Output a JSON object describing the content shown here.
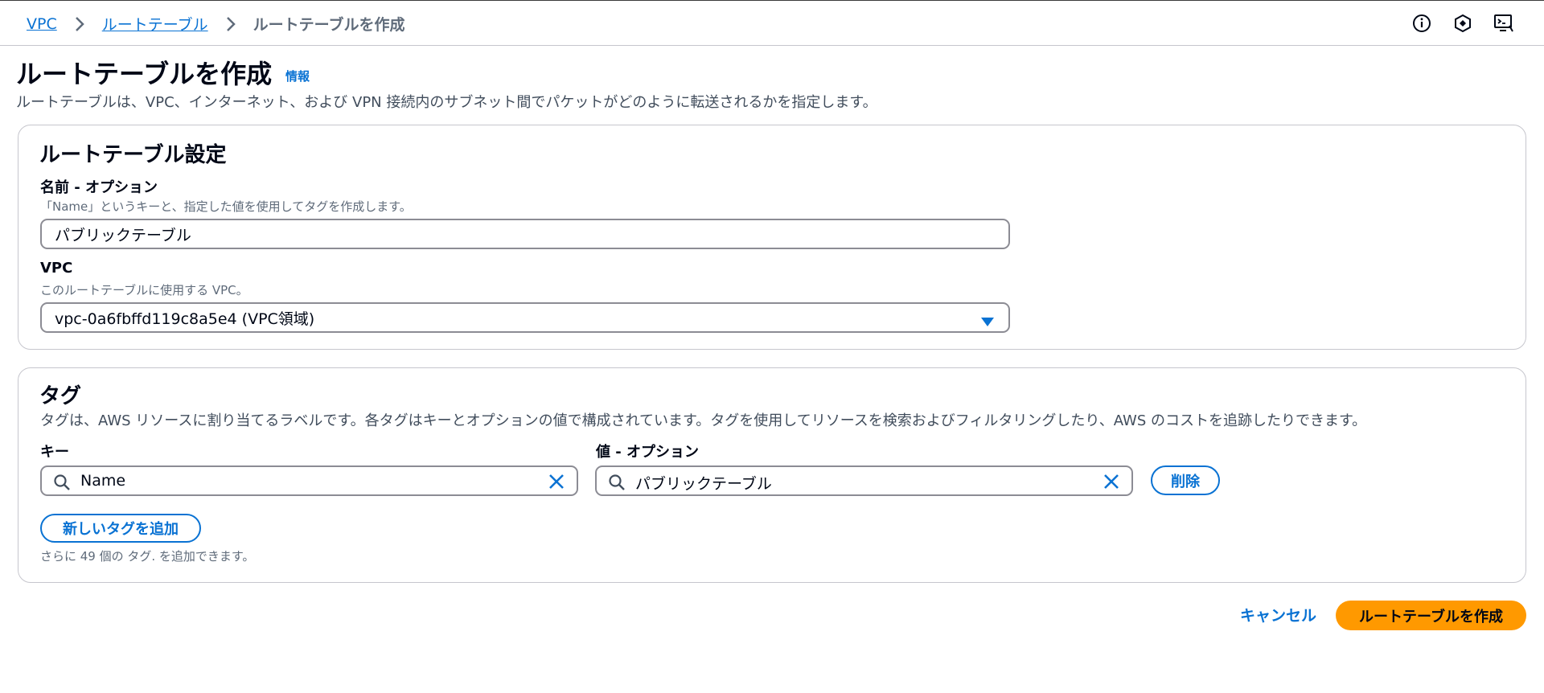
{
  "breadcrumb": {
    "items": [
      "VPC",
      "ルートテーブル"
    ],
    "current": "ルートテーブルを作成"
  },
  "header_icons": [
    "info-circle-icon",
    "hexagon-icon",
    "terminal-screen-icon"
  ],
  "page": {
    "title": "ルートテーブルを作成",
    "info_link": "情報",
    "description": "ルートテーブルは、VPC、インターネット、および VPN 接続内のサブネット間でパケットがどのように転送されるかを指定します。"
  },
  "settings": {
    "title": "ルートテーブル設定",
    "name_label": "名前 - オプション",
    "name_help": "「Name」というキーと、指定した値を使用してタグを作成します。",
    "name_value": "パブリックテーブル",
    "vpc_label": "VPC",
    "vpc_help": "このルートテーブルに使用する VPC。",
    "vpc_value": "vpc-0a6fbffd119c8a5e4 (VPC領域)"
  },
  "tags": {
    "title": "タグ",
    "description": "タグは、AWS リソースに割り当てるラベルです。各タグはキーとオプションの値で構成されています。タグを使用してリソースを検索およびフィルタリングしたり、AWS のコストを追跡したりできます。",
    "key_label": "キー",
    "value_label": "値 - オプション",
    "key_value": "Name",
    "value_value": "パブリックテーブル",
    "remove_label": "削除",
    "add_label": "新しいタグを追加",
    "limit_note": "さらに 49 個の タグ. を追加できます。"
  },
  "footer": {
    "cancel_label": "キャンセル",
    "submit_label": "ルートテーブルを作成"
  },
  "colors": {
    "link": "#0972d3",
    "primary": "#ff9900",
    "border": "#8c8c94",
    "text": "#000716"
  }
}
